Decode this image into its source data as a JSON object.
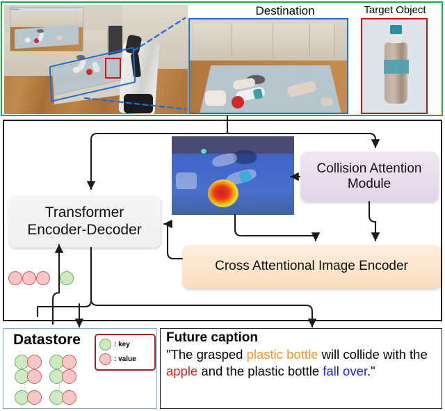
{
  "figure": {
    "top": {
      "labels": {
        "destination": "Destination",
        "target_object": "Target Object"
      },
      "scene_image_name": "robot-kitchen-scene",
      "inset_window_title": "Camera 1",
      "boxes": {
        "outer_border_color": "#1faa3c",
        "destination_border_color": "#1a6fd4",
        "target_border_color": "#cc1111"
      }
    },
    "middle": {
      "nodes": [
        {
          "id": "transformer",
          "label": "Transformer\nEncoder-Decoder",
          "label_line1": "Transformer",
          "label_line2": "Encoder-Decoder",
          "color": "#f2f2f2"
        },
        {
          "id": "collision",
          "label": "Collision Attention Module",
          "label_line1": "Collision Attention",
          "label_line2": "Module",
          "color": "#e8d9ec"
        },
        {
          "id": "encoder",
          "label": "Cross Attentional Image Encoder",
          "color": "#fbddbf"
        }
      ],
      "heatmap_name": "collision-attention-heatmap",
      "token_circles": [
        {
          "type": "value",
          "color": "#f7c7c7"
        },
        {
          "type": "value",
          "color": "#f7c7c7"
        },
        {
          "type": "value",
          "color": "#f7c7c7"
        },
        {
          "type": "key",
          "color": "#cfe9c2"
        }
      ]
    },
    "datastore": {
      "title": "Datastore",
      "legend": [
        {
          "symbol": "key-circle",
          "text": ": key",
          "color": "#cfe9c2"
        },
        {
          "symbol": "value-circle",
          "text": ": value",
          "color": "#f7c7c7"
        }
      ],
      "pair_rows": 3,
      "pair_cols": 2,
      "ellipsis": "⋮"
    },
    "caption": {
      "title": "Future caption",
      "open_quote": "\"The grasped ",
      "highlight_1": "plastic bottle",
      "mid_1": " will collide with the ",
      "highlight_2": "apple",
      "mid_2": " and the plastic bottle ",
      "highlight_3": "fall over",
      "close_quote": ".\"",
      "full_text": "\"The grasped plastic bottle will collide with the apple and the plastic bottle fall over.\"",
      "colors": {
        "plastic_bottle": "#f7931e",
        "apple": "#e31b1b",
        "fall_over": "#1021e8"
      }
    }
  }
}
